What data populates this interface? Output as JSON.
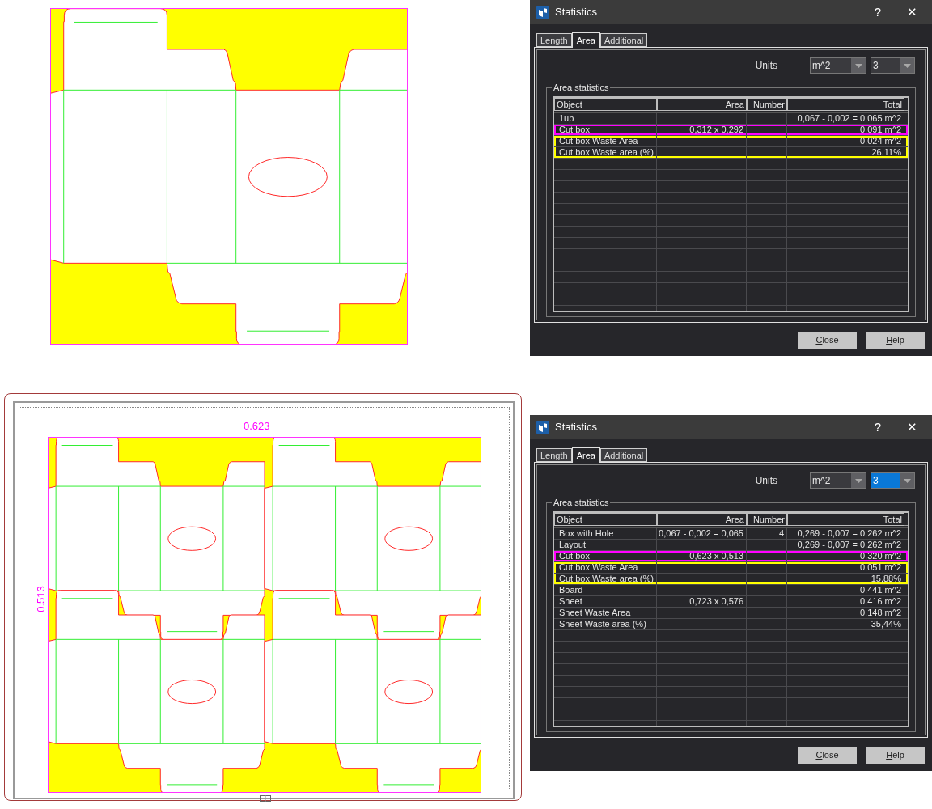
{
  "panels": [
    {
      "drawing": {
        "kind": "single"
      },
      "dialog": {
        "title": "Statistics",
        "help": "?",
        "close": "✕",
        "tabs": [
          {
            "label": "Length",
            "selected": false
          },
          {
            "label": "Area",
            "selected": true
          },
          {
            "label": "Additional",
            "selected": false
          }
        ],
        "units_label": "Units",
        "selects": [
          {
            "value": "m^2",
            "focused": false
          },
          {
            "value": "3",
            "focused": false
          }
        ],
        "group_title": "Area statistics",
        "columns": [
          "Object",
          "Area",
          "Number",
          "Total"
        ],
        "rows": [
          {
            "cells": [
              "1up",
              "",
              "",
              "0,067 - 0,002 = 0,065 m^2"
            ]
          },
          {
            "cells": [
              "Cut box",
              "0,312 x 0,292",
              "",
              "0,091 m^2"
            ],
            "color": "#ff00ff"
          },
          {
            "cells": [
              "Cut box Waste Area",
              "",
              "",
              "0,024 m^2"
            ],
            "color": "#ffff00"
          },
          {
            "cells": [
              "Cut box Waste area (%)",
              "",
              "",
              "26,11%"
            ],
            "color": "#ffff00"
          }
        ],
        "buttons": [
          "Close",
          "Help"
        ]
      }
    },
    {
      "drawing": {
        "kind": "sheet",
        "width_label": "0.623",
        "height_label": "0.513"
      },
      "dialog": {
        "title": "Statistics",
        "help": "?",
        "close": "✕",
        "tabs": [
          {
            "label": "Length",
            "selected": false
          },
          {
            "label": "Area",
            "selected": true
          },
          {
            "label": "Additional",
            "selected": false
          }
        ],
        "units_label": "Units",
        "selects": [
          {
            "value": "m^2",
            "focused": false
          },
          {
            "value": "3",
            "focused": true
          }
        ],
        "group_title": "Area statistics",
        "columns": [
          "Object",
          "Area",
          "Number",
          "Total"
        ],
        "rows": [
          {
            "cells": [
              "Box with Hole",
              "0,067 - 0,002 = 0,065",
              "4",
              "0,269 - 0,007 = 0,262 m^2"
            ]
          },
          {
            "cells": [
              "Layout",
              "",
              "",
              "0,269 - 0,007 = 0,262 m^2"
            ]
          },
          {
            "cells": [
              "Cut box",
              "0,623 x 0,513",
              "",
              "0,320 m^2"
            ],
            "color": "#ff00ff"
          },
          {
            "cells": [
              "Cut box Waste Area",
              "",
              "",
              "0,051 m^2"
            ],
            "color": "#ffff00"
          },
          {
            "cells": [
              "Cut box Waste area (%)",
              "",
              "",
              "15,88%"
            ],
            "color": "#ffff00"
          },
          {
            "cells": [
              "Board",
              "",
              "",
              "0,441 m^2"
            ]
          },
          {
            "cells": [
              "Sheet",
              "0,723 x 0,576",
              "",
              "0,416 m^2"
            ]
          },
          {
            "cells": [
              "Sheet Waste Area",
              "",
              "",
              "0,148 m^2"
            ]
          },
          {
            "cells": [
              "Sheet Waste area (%)",
              "",
              "",
              "35,44%"
            ]
          }
        ],
        "buttons": [
          "Close",
          "Help"
        ]
      }
    }
  ]
}
